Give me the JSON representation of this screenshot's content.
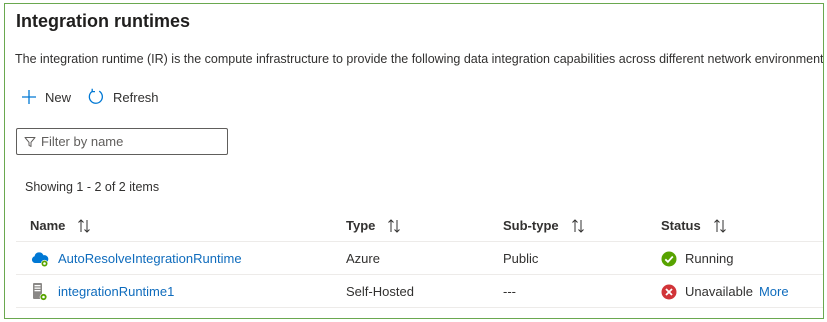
{
  "page": {
    "title": "Integration runtimes",
    "description": "The integration runtime (IR) is the compute infrastructure to provide the following data integration capabilities across different network environments."
  },
  "toolbar": {
    "new_label": "New",
    "refresh_label": "Refresh"
  },
  "filter": {
    "placeholder": "Filter by name",
    "value": ""
  },
  "list": {
    "showing_text": "Showing 1 - 2 of 2 items",
    "columns": [
      {
        "label": "Name"
      },
      {
        "label": "Type"
      },
      {
        "label": "Sub-type"
      },
      {
        "label": "Status"
      }
    ],
    "rows": [
      {
        "icon": "azure-cloud-ir-icon",
        "name": "AutoResolveIntegrationRuntime",
        "type": "Azure",
        "subtype": "Public",
        "status_icon": "success-check-icon",
        "status": "Running",
        "status_link": ""
      },
      {
        "icon": "self-hosted-server-icon",
        "name": "integrationRuntime1",
        "type": "Self-Hosted",
        "subtype": "---",
        "status_icon": "error-x-icon",
        "status": "Unavailable",
        "status_link": "More"
      }
    ]
  },
  "colors": {
    "frame_border": "#6aa84f",
    "link": "#0f6cbd",
    "success": "#107c10",
    "error": "#d13438",
    "accent": "#0078d4"
  }
}
